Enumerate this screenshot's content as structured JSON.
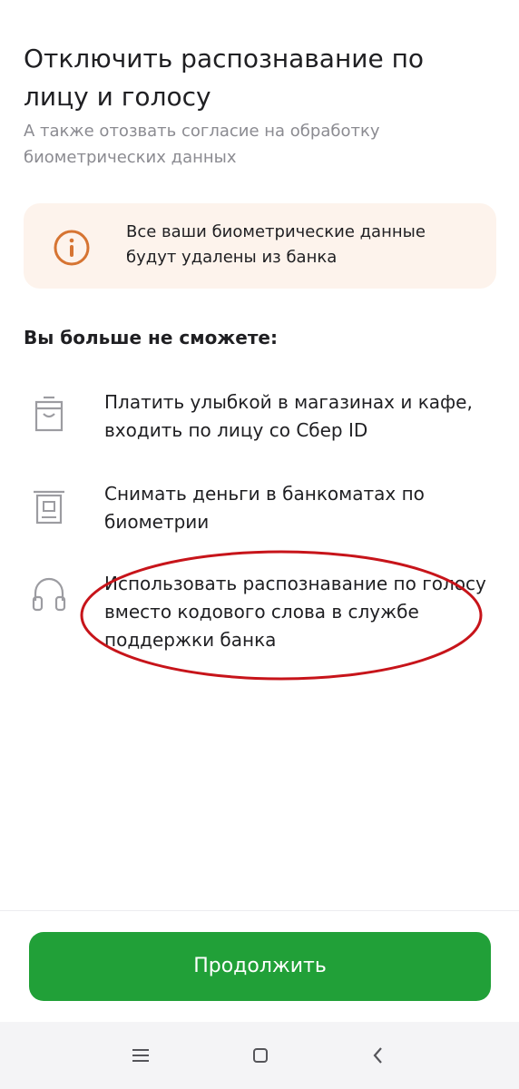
{
  "header": {
    "title": "Отключить распознавание по лицу и голосу",
    "subtitle": "А также отозвать согласие на обработку биометрических данных"
  },
  "warning": {
    "icon": "info-icon",
    "text": "Все ваши биометрические данные будут удалены из банка",
    "accent_color": "#d67432",
    "background_color": "#fdf3ec"
  },
  "features": {
    "heading": "Вы больше не сможете:",
    "items": [
      {
        "icon": "shopping-bag-icon",
        "text": "Платить улыбкой в магазинах и кафе, входить по лицу со Сбер ID"
      },
      {
        "icon": "atm-icon",
        "text": "Снимать деньги в банкоматах по биометрии"
      },
      {
        "icon": "headphones-icon",
        "text": "Использовать распознавание по голосу вместо кодового слова в службе поддержки банка"
      }
    ]
  },
  "actions": {
    "continue_label": "Продолжить",
    "continue_color": "#21a038"
  },
  "annotation": {
    "highlight_color": "#c7141a"
  },
  "system_nav": {
    "items": [
      {
        "icon": "menu-icon"
      },
      {
        "icon": "home-icon"
      },
      {
        "icon": "back-icon"
      }
    ]
  }
}
